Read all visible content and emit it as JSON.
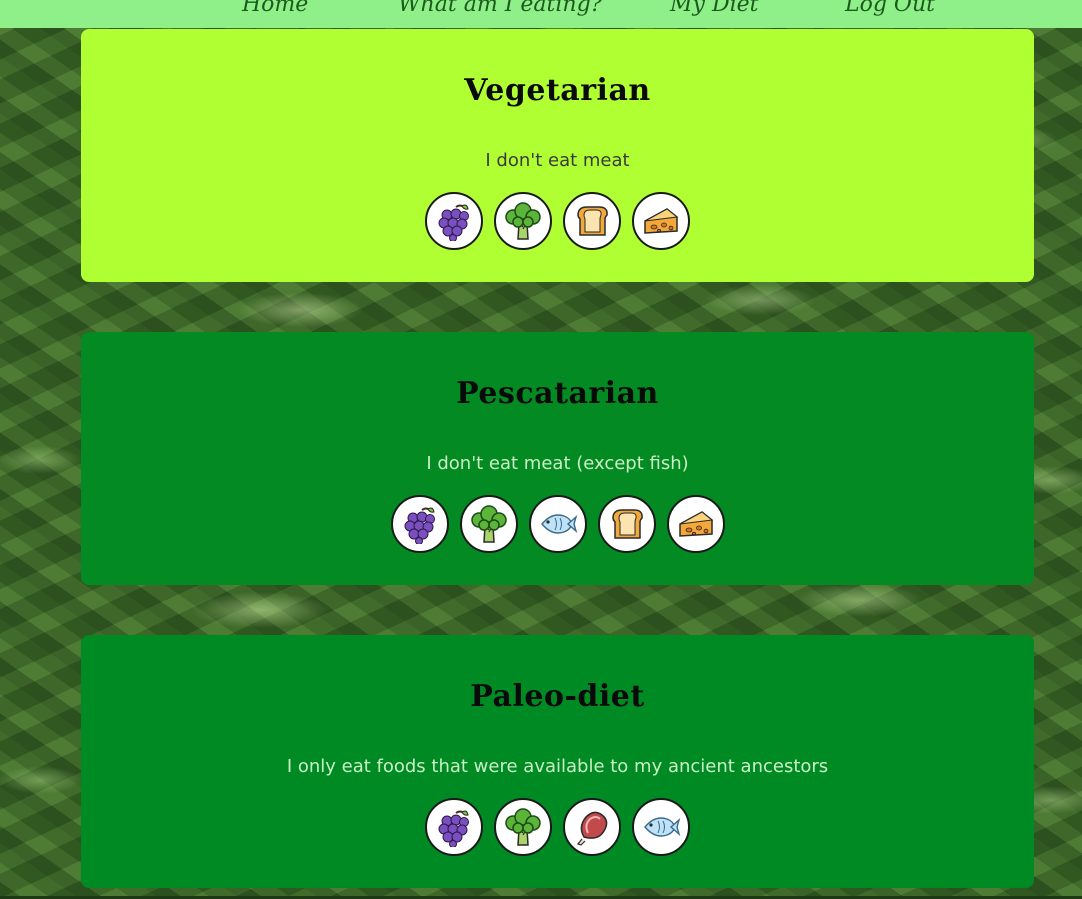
{
  "nav": {
    "items": [
      {
        "label": "Home"
      },
      {
        "label": "What am I eating?"
      },
      {
        "label": "My Diet"
      },
      {
        "label": "Log Out"
      }
    ]
  },
  "diets": [
    {
      "title": "Vegetarian",
      "description": "I don't eat meat",
      "foods": [
        "grapes-icon",
        "broccoli-icon",
        "bread-icon",
        "cheese-icon"
      ]
    },
    {
      "title": "Pescatarian",
      "description": "I don't eat meat (except fish)",
      "foods": [
        "grapes-icon",
        "broccoli-icon",
        "fish-icon",
        "bread-icon",
        "cheese-icon"
      ]
    },
    {
      "title": "Paleo-diet",
      "description": "I only eat foods that were available to my ancient ancestors",
      "foods": [
        "grapes-icon",
        "broccoli-icon",
        "ham-icon",
        "fish-icon"
      ]
    }
  ],
  "colors": {
    "nav_bg": "#8ff08a",
    "vegetarian_card": "#b0ff33",
    "pescatarian_card": "#048a22",
    "paleo_card": "#008a24"
  }
}
